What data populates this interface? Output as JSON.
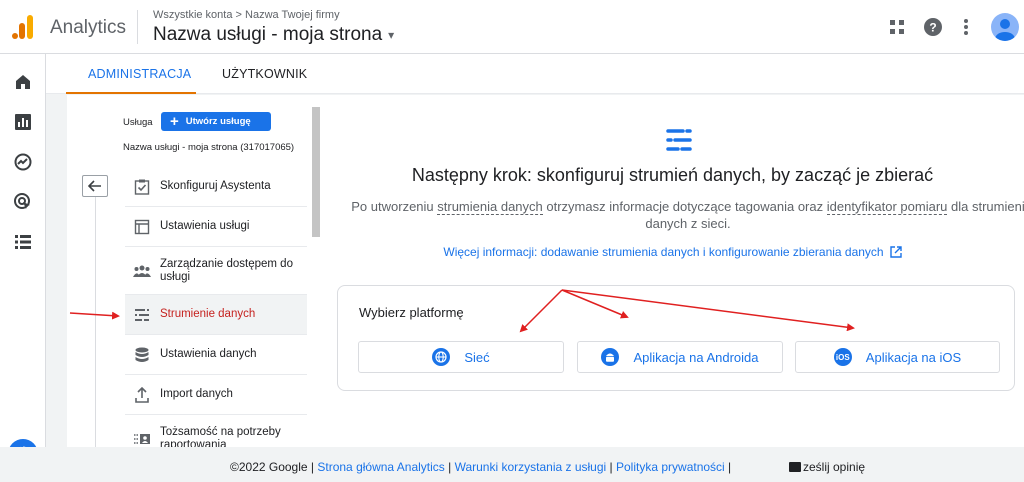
{
  "app": {
    "name": "Analytics"
  },
  "header": {
    "breadcrumb": [
      "Wszystkie konta",
      "Nazwa Twojej firmy"
    ],
    "breadcrumb_sep": ">",
    "property_name": "Nazwa usługi - moja strona",
    "property_caret": "▾"
  },
  "top_icons": [
    "apps-icon",
    "help-icon",
    "more-vert-icon",
    "account-avatar"
  ],
  "rail": {
    "items": [
      "home-icon",
      "reports-icon",
      "explore-icon",
      "advertising-icon",
      "configure-icon"
    ],
    "settings": "admin-gear-icon"
  },
  "tabs": [
    {
      "label": "ADMINISTRACJA",
      "active": true
    },
    {
      "label": "UŻYTKOWNIK",
      "active": false
    }
  ],
  "settings": {
    "service_label": "Usługa",
    "create_button": "Utwórz usługę",
    "service_name": "Nazwa usługi - moja strona (317017065)",
    "menu": [
      {
        "label": "Skonfiguruj Asystenta",
        "icon": "checklist-icon"
      },
      {
        "label": "Ustawienia usługi",
        "icon": "property-settings-icon"
      },
      {
        "label": "Zarządzanie dostępem do usługi",
        "icon": "people-icon"
      },
      {
        "label": "Strumienie danych",
        "icon": "data-streams-icon",
        "active": true
      },
      {
        "label": "Ustawienia danych",
        "icon": "database-icon"
      },
      {
        "label": "Import danych",
        "icon": "upload-icon"
      },
      {
        "label": "Tożsamość na potrzeby raportowania",
        "icon": "identity-icon"
      }
    ]
  },
  "main": {
    "headline": "Następny krok: skonfiguruj strumień danych, by zacząć je zbierać",
    "desc_1": "Po utworzeniu ",
    "desc_term_1": "strumienia danych",
    "desc_2": " otrzymasz informacje dotyczące tagowania oraz ",
    "desc_term_2": "identyfikator pomiaru",
    "desc_3": " dla strumieni danych z sieci.",
    "more_link": "Więcej informacji: dodawanie strumienia danych i konfigurowanie zbierania danych",
    "platform_title": "Wybierz platformę",
    "platforms": [
      {
        "label": "Sieć",
        "icon": "globe-icon"
      },
      {
        "label": "Aplikacja na Androida",
        "icon": "android-icon"
      },
      {
        "label": "Aplikacja na iOS",
        "icon": "ios-icon",
        "badge": "iOS"
      }
    ]
  },
  "footer": {
    "copyright": "©2022 Google",
    "sep": " | ",
    "links": [
      "Strona główna Analytics",
      "Warunki korzystania z usługi",
      "Polityka prywatności"
    ],
    "feedback": "ześlij opinię"
  },
  "colors": {
    "accent": "#1a73e8",
    "active_tab_underline": "#e37400",
    "annotation": "#e02020",
    "active_item_text": "#c5221f"
  }
}
